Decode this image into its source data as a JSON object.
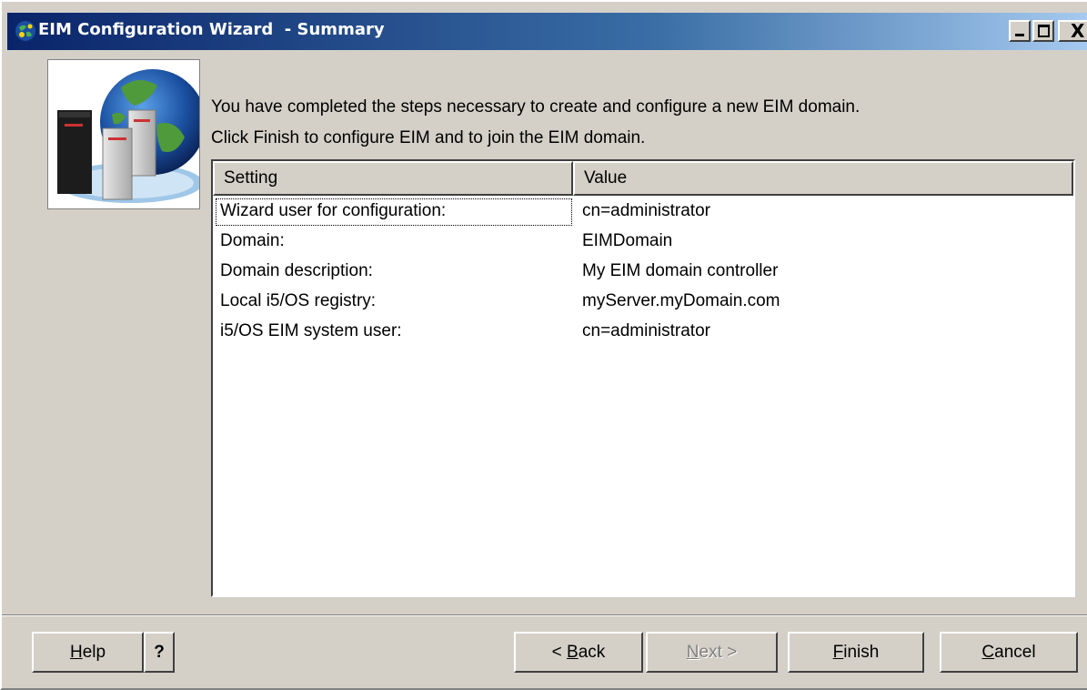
{
  "window": {
    "title": "EIM Configuration Wizard  - Summary",
    "controls": {
      "close": "X"
    }
  },
  "intro": {
    "line1": "You have completed the steps necessary to create and configure a new EIM domain.",
    "line2": "Click Finish to configure EIM and to join the EIM domain."
  },
  "table": {
    "headers": {
      "setting": "Setting",
      "value": "Value"
    },
    "rows": [
      {
        "setting": "Wizard user for configuration:",
        "value": "cn=administrator"
      },
      {
        "setting": "Domain:",
        "value": "EIMDomain"
      },
      {
        "setting": "Domain description:",
        "value": "My EIM domain controller"
      },
      {
        "setting": "Local i5/OS registry:",
        "value": "myServer.myDomain.com"
      },
      {
        "setting": "i5/OS EIM system user:",
        "value": "cn=administrator"
      }
    ]
  },
  "buttons": {
    "help": {
      "mnemonic": "H",
      "rest": "elp"
    },
    "question": "?",
    "back": {
      "prefix": "< ",
      "mnemonic": "B",
      "rest": "ack"
    },
    "next": {
      "mnemonic": "N",
      "rest": "ext >"
    },
    "finish": {
      "mnemonic": "F",
      "rest": "inish"
    },
    "cancel": {
      "mnemonic": "C",
      "rest": "ancel"
    }
  }
}
